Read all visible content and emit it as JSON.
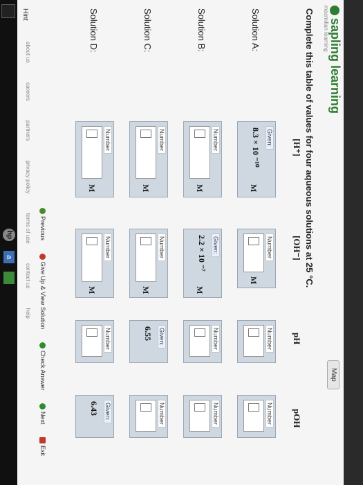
{
  "brand": {
    "name": "sapling learning",
    "sub": "macmillan learning"
  },
  "map_label": "Map",
  "instruction": "Complete this table of values for four aqueous solutions at 25 °C.",
  "headers": {
    "h": "[H⁺]",
    "oh": "[OH⁻]",
    "ph": "pH",
    "poh": "pOH"
  },
  "rows": [
    {
      "label": "Solution A:"
    },
    {
      "label": "Solution B:"
    },
    {
      "label": "Solution C:"
    },
    {
      "label": "Solution D:"
    }
  ],
  "cells": {
    "given_tag": "Given:",
    "number_tag": "Number",
    "unit_m": "M",
    "a_h_value": "8.3 × 10 ⁻¹⁰",
    "b_oh_value": "2.2 × 10 ⁻⁷",
    "c_ph_value": "6.55",
    "d_poh_value": "6.43"
  },
  "nav": {
    "previous": "Previous",
    "give_up": "Give Up & View Solution",
    "check": "Check Answer",
    "next": "Next",
    "exit": "Exit"
  },
  "hint": "Hint",
  "footer": {
    "about": "about us",
    "careers": "careers",
    "partners": "partners",
    "privacy": "privacy policy",
    "terms": "terms of use",
    "contact": "contact us",
    "help": "help"
  },
  "taskbar": {
    "hp": "hp",
    "a": "a"
  },
  "colors": {
    "brand_green": "#2e7d32",
    "cell_bg": "#cfd8e0"
  }
}
